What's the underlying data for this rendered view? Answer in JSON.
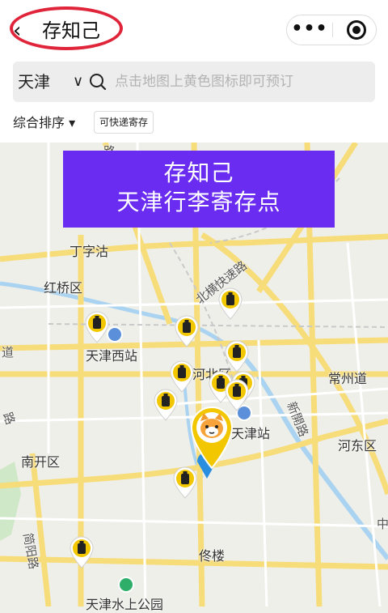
{
  "header": {
    "title": "存知己",
    "back_icon": "chevron-left-icon",
    "more_icon": "more-dots",
    "target_icon": "target-icon",
    "highlight_color": "#e0243a"
  },
  "search": {
    "city": "天津",
    "city_chevron": "∨",
    "placeholder": "点击地图上黄色图标即可预订"
  },
  "filters": {
    "sort_label": "综合排序 ▾",
    "express_tag": "可快递寄存"
  },
  "banner": {
    "line1": "存知己",
    "line2": "天津行李寄存点",
    "color": "#6a2cf0"
  },
  "map": {
    "labels": {
      "dingzigu": "丁字沽",
      "hongqiao": "红桥区",
      "tianjin_west": "天津西站",
      "hebei": "河北区",
      "changzhou": "常州道",
      "tianjin_station": "天津站",
      "hedong": "河东区",
      "nankai": "南开区",
      "tonglou": "佟楼",
      "water_park": "天津水上公园",
      "beiheng_road": "北横快速路",
      "xinkai_road": "新開路",
      "jianyang_road": "简阳路",
      "road_left": "道",
      "road_left2": "路",
      "road_top": "路",
      "road_right": "中"
    },
    "pin_color": "#f2c700",
    "location_color": "#2a8ee0"
  }
}
